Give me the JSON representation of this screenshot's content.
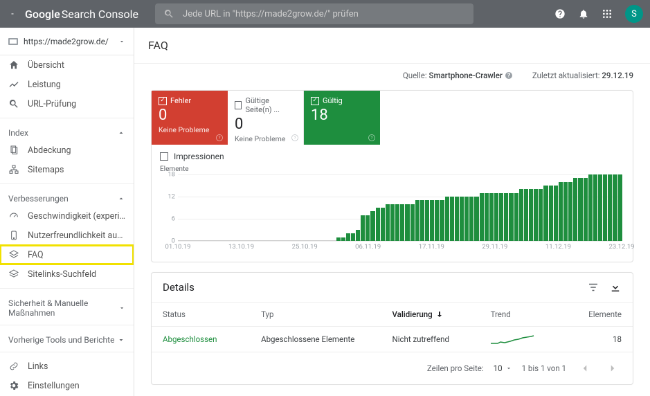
{
  "header": {
    "logo_prefix": "Google",
    "logo_text": "Search Console",
    "search_placeholder": "Jede URL in \"https://made2grow.de/\" prüfen",
    "avatar_letter": "S"
  },
  "property": {
    "url": "https://made2grow.de/"
  },
  "nav": {
    "overview": "Übersicht",
    "performance": "Leistung",
    "inspect": "URL-Prüfung",
    "index_section": "Index",
    "coverage": "Abdeckung",
    "sitemaps": "Sitemaps",
    "enhancements_section": "Verbesserungen",
    "speed": "Geschwindigkeit (experimentell)",
    "mobile": "Nutzerfreundlichkeit auf Mobilgeräten",
    "faq": "FAQ",
    "sitelinks": "Sitelinks-Suchfeld",
    "security_section": "Sicherheit & Manuelle Maßnahmen",
    "legacy_section": "Vorherige Tools und Berichte",
    "links": "Links",
    "settings": "Einstellungen"
  },
  "page": {
    "title": "FAQ",
    "source_label": "Quelle:",
    "source_value": "Smartphone-Crawler",
    "updated_label": "Zuletzt aktualisiert:",
    "updated_value": "29.12.19"
  },
  "tiles": {
    "error": {
      "label": "Fehler",
      "value": "0",
      "footer": "Keine Probleme"
    },
    "warn": {
      "label": "Gültige Seite(n) ...",
      "value": "0",
      "footer": "Keine Probleme"
    },
    "valid": {
      "label": "Gültig",
      "value": "18",
      "footer": ""
    }
  },
  "impressions_label": "Impressionen",
  "chart_data": {
    "type": "bar",
    "title": "",
    "ylabel": "Elemente",
    "yticks": [
      0,
      6,
      12,
      18
    ],
    "ylim": [
      0,
      18
    ],
    "categories": [
      "01.10.19",
      "13.10.19",
      "25.10.19",
      "06.11.19",
      "17.11.19",
      "29.11.19",
      "11.12.19",
      "23.12.19"
    ],
    "values": [
      0,
      0,
      0,
      0,
      0,
      0,
      0,
      0,
      0,
      0,
      0,
      0,
      0,
      0,
      0,
      0,
      0,
      0,
      0,
      0,
      0,
      0,
      0,
      0,
      0,
      0,
      0,
      0,
      0,
      0,
      0,
      0,
      1,
      1,
      2,
      2,
      3,
      7,
      7,
      8,
      9,
      9,
      10,
      10,
      10,
      10,
      10,
      10,
      11,
      11,
      11,
      11,
      11,
      11,
      12,
      12,
      12,
      12,
      12,
      12,
      12,
      13,
      13,
      13,
      13,
      13,
      13,
      13,
      13,
      14,
      14,
      14,
      14,
      14,
      15,
      15,
      15,
      16,
      16,
      16,
      17,
      17,
      17,
      18,
      18,
      18,
      18,
      18,
      18,
      18
    ]
  },
  "details": {
    "heading": "Details",
    "cols": {
      "status": "Status",
      "type": "Typ",
      "validation": "Validierung",
      "trend": "Trend",
      "elements": "Elemente"
    },
    "rows": [
      {
        "status": "Abgeschlossen",
        "type": "Abgeschlossene Elemente",
        "validation": "Nicht zutreffend",
        "elements": "18"
      }
    ],
    "pager": {
      "rows_label": "Zeilen pro Seite:",
      "rows_value": "10",
      "range": "1 bis 1 von 1"
    }
  }
}
